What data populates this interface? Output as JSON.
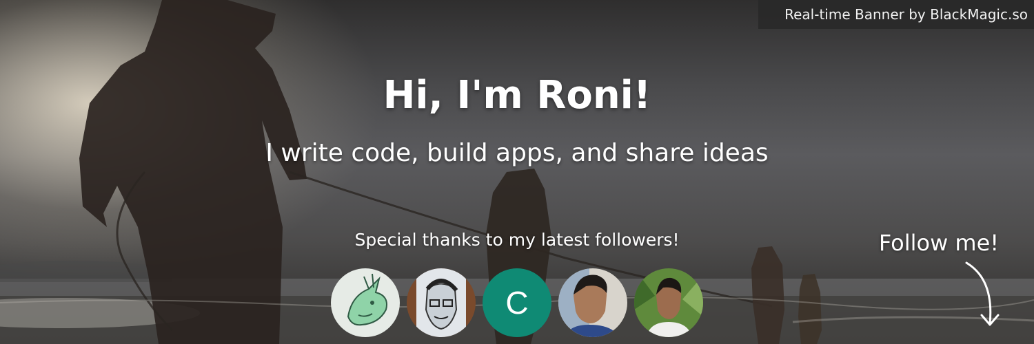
{
  "banner": {
    "brand_tag": "Real-time Banner by BlackMagic.so",
    "headline": "Hi, I'm Roni!",
    "tagline": "I write code, build apps, and share ideas",
    "followers_heading": "Special thanks to my latest followers!",
    "follow_cta": "Follow me!"
  },
  "followers": [
    {
      "kind": "image",
      "depicts": "green dragon drawing"
    },
    {
      "kind": "image",
      "depicts": "sketched portrait"
    },
    {
      "kind": "initial",
      "letter": "C",
      "color": "#0f8a74"
    },
    {
      "kind": "image",
      "depicts": "young man photo"
    },
    {
      "kind": "image",
      "depicts": "man among plants photo"
    }
  ],
  "icons": {
    "follow_arrow": "curved-arrow-down-icon"
  },
  "colors": {
    "text": "#ffffff",
    "brand_tag_bg": "#282828",
    "initial_avatar": "#0f8a74"
  }
}
